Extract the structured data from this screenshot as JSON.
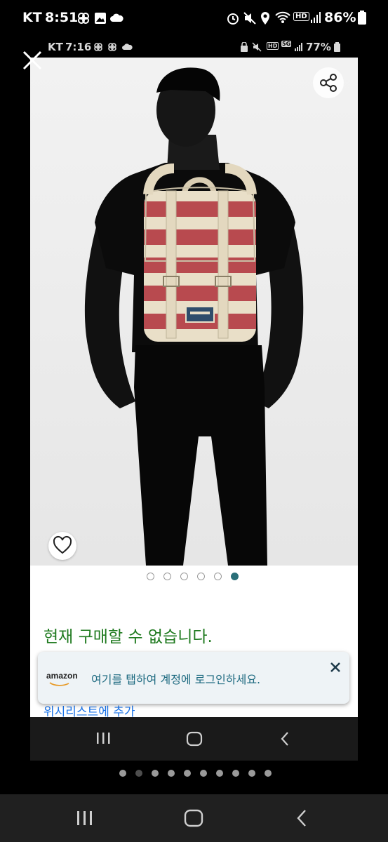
{
  "outer_status": {
    "carrier": "KT",
    "time": "8:51",
    "battery": "86%",
    "left_icons": [
      "pinwheel-icon",
      "image-icon",
      "cloud-icon"
    ],
    "right_icons": [
      "alarm-icon",
      "mute-icon",
      "location-icon",
      "wifi-icon",
      "hd-icon",
      "signal-icon",
      "battery-icon"
    ]
  },
  "inner_status": {
    "carrier": "KT",
    "time": "7:16",
    "battery": "77%",
    "right_icons": [
      "lock-icon",
      "mute-icon",
      "hd-icon",
      "5g-icon",
      "signal-icon",
      "battery-icon"
    ]
  },
  "product": {
    "image_count": 6,
    "active_image_index": 5,
    "availability": "현재 구매할 수 없습니다.",
    "partial_text": "위시리스트에 추가"
  },
  "banner": {
    "logo": "amazon",
    "message": "여기를 탭하여 계정에 로그인하세요."
  },
  "outer_page_dots": {
    "count": 10,
    "active_index": 0
  },
  "colors": {
    "availability": "#1f7a1f",
    "banner_text": "#1d6a80",
    "active_dot": "#2a6f78",
    "backpack_red": "#b84a4f",
    "backpack_cream": "#e9dfc8"
  }
}
